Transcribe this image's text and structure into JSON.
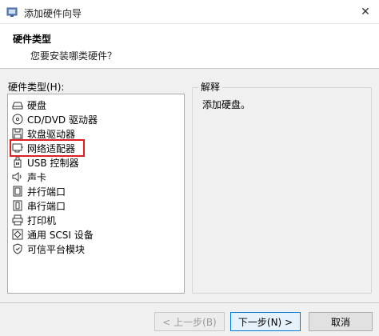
{
  "window": {
    "title": "添加硬件向导",
    "close_glyph": "✕"
  },
  "header": {
    "title": "硬件类型",
    "subtitle": "您要安装哪类硬件？"
  },
  "list": {
    "label": "硬件类型(H):",
    "selected_index": 3,
    "items": [
      {
        "label": "硬盘",
        "icon": "hard-disk-icon"
      },
      {
        "label": "CD/DVD 驱动器",
        "icon": "cd-dvd-icon"
      },
      {
        "label": "软盘驱动器",
        "icon": "floppy-icon"
      },
      {
        "label": "网络适配器",
        "icon": "network-adapter-icon"
      },
      {
        "label": "USB 控制器",
        "icon": "usb-icon"
      },
      {
        "label": "声卡",
        "icon": "sound-card-icon"
      },
      {
        "label": "并行端口",
        "icon": "parallel-port-icon"
      },
      {
        "label": "串行端口",
        "icon": "serial-port-icon"
      },
      {
        "label": "打印机",
        "icon": "printer-icon"
      },
      {
        "label": "通用 SCSI 设备",
        "icon": "scsi-icon"
      },
      {
        "label": "可信平台模块",
        "icon": "tpm-icon"
      }
    ]
  },
  "explanation": {
    "title": "解释",
    "text": "添加硬盘。"
  },
  "buttons": {
    "back": "< 上一步(B)",
    "next": "下一步(N) >",
    "cancel": "取消"
  },
  "colors": {
    "selection_outline": "#e02020",
    "primary_border": "#0078d7"
  }
}
